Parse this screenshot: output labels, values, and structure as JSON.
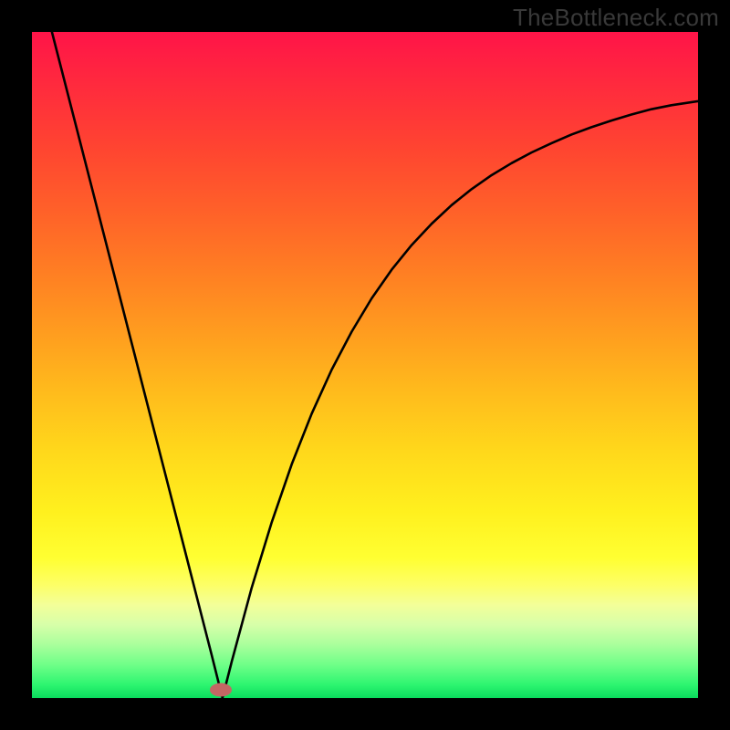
{
  "watermark": "TheBottleneck.com",
  "chart_data": {
    "type": "line",
    "title": "",
    "xlabel": "",
    "ylabel": "",
    "xlim": [
      0,
      1
    ],
    "ylim": [
      0,
      1
    ],
    "x": [
      0.03,
      0.06,
      0.09,
      0.12,
      0.15,
      0.18,
      0.21,
      0.24,
      0.27,
      0.286,
      0.3,
      0.33,
      0.36,
      0.39,
      0.42,
      0.45,
      0.48,
      0.51,
      0.54,
      0.57,
      0.6,
      0.63,
      0.66,
      0.69,
      0.72,
      0.75,
      0.78,
      0.81,
      0.84,
      0.87,
      0.9,
      0.93,
      0.96,
      1.0
    ],
    "values": [
      1.0,
      0.883,
      0.766,
      0.649,
      0.532,
      0.415,
      0.298,
      0.181,
      0.064,
      0.0,
      0.055,
      0.166,
      0.264,
      0.351,
      0.427,
      0.493,
      0.55,
      0.6,
      0.643,
      0.68,
      0.712,
      0.74,
      0.764,
      0.785,
      0.803,
      0.819,
      0.833,
      0.846,
      0.857,
      0.867,
      0.876,
      0.884,
      0.89,
      0.896
    ],
    "marker": {
      "x": 0.284,
      "y": 0.012
    },
    "background_gradient": [
      "#FF1448",
      "#FF7E23",
      "#FFD81B",
      "#FFFF32",
      "#6FFF88",
      "#0ADC5D"
    ]
  }
}
